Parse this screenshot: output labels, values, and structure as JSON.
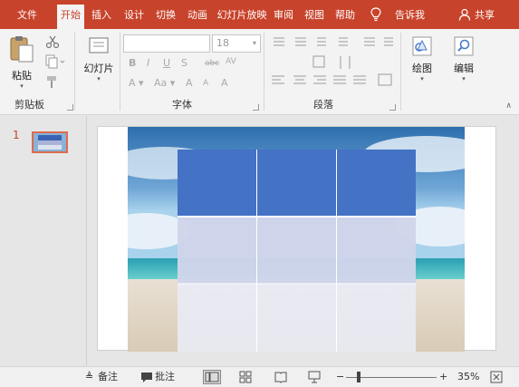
{
  "tabs": [
    {
      "label": "文件",
      "active": false
    },
    {
      "label": "开始",
      "active": true
    },
    {
      "label": "插入",
      "active": false
    },
    {
      "label": "设计",
      "active": false
    },
    {
      "label": "切换",
      "active": false
    },
    {
      "label": "动画",
      "active": false
    },
    {
      "label": "幻灯片放映",
      "active": false
    },
    {
      "label": "审阅",
      "active": false
    },
    {
      "label": "视图",
      "active": false
    },
    {
      "label": "帮助",
      "active": false
    }
  ],
  "tell_me": "告诉我",
  "share": "共享",
  "ribbon": {
    "paste_label": "粘贴",
    "clipboard_group": "剪贴板",
    "slides_label": "幻灯片",
    "font_group": "字体",
    "font_size": "18",
    "font_name": "",
    "paragraph_group": "段落",
    "drawing_label": "绘图",
    "editing_label": "编辑"
  },
  "thumbnails": [
    {
      "number": "1"
    }
  ],
  "status": {
    "notes_label": "备注",
    "comments_label": "批注",
    "zoom_percent": "35%",
    "zoom_level": 0.35
  },
  "colors": {
    "brand": "#c8432b",
    "table_header": "#4472c4",
    "table_band1": "#cfd5ea",
    "table_band2": "#e9ebf5"
  }
}
